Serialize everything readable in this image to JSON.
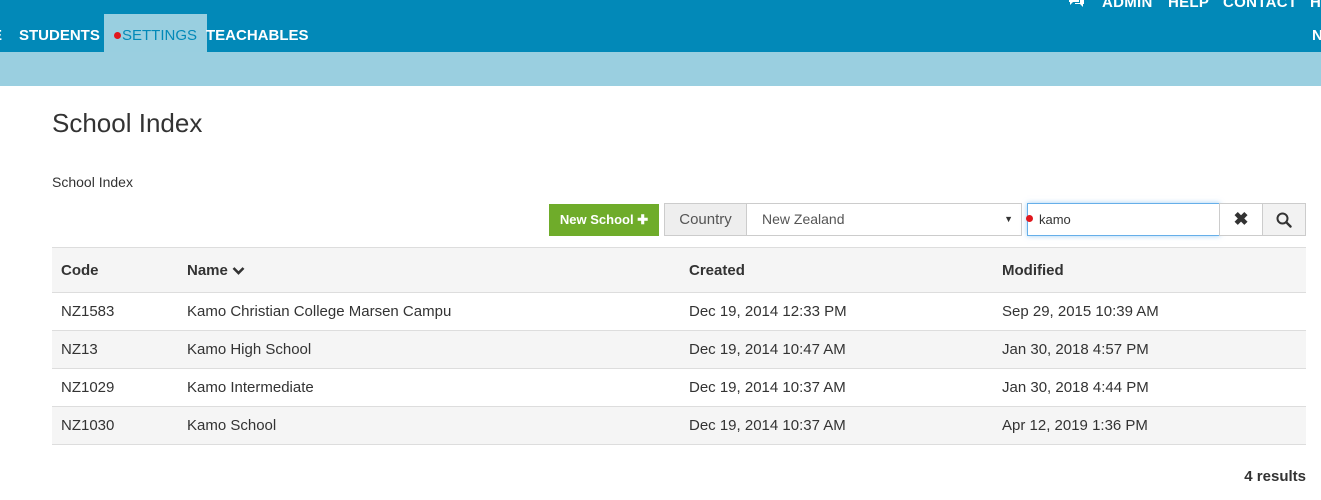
{
  "header": {
    "utility_links": [
      "ADMIN",
      "HELP",
      "CONTACT",
      "H"
    ],
    "nav_partial_left": "E",
    "nav_tabs": [
      {
        "label": "STUDENTS"
      },
      {
        "label": "SETTINGS",
        "active": true
      },
      {
        "label": "TEACHABLES"
      }
    ],
    "nav_partial_right": "N"
  },
  "page": {
    "title": "School Index",
    "breadcrumb": "School Index"
  },
  "toolbar": {
    "new_school_label": "New School",
    "country_label": "Country",
    "country_selected": "New Zealand",
    "search_value": "kamo"
  },
  "table": {
    "columns": [
      "Code",
      "Name",
      "Created",
      "Modified"
    ],
    "sort_column": "Name",
    "rows": [
      {
        "code": "NZ1583",
        "name": "Kamo Christian College Marsen Campu",
        "created": "Dec 19, 2014 12:33 PM",
        "modified": "Sep 29, 2015 10:39 AM"
      },
      {
        "code": "NZ13",
        "name": "Kamo High School",
        "created": "Dec 19, 2014 10:47 AM",
        "modified": "Jan 30, 2018 4:57 PM"
      },
      {
        "code": "NZ1029",
        "name": "Kamo Intermediate",
        "created": "Dec 19, 2014 10:37 AM",
        "modified": "Jan 30, 2018 4:44 PM"
      },
      {
        "code": "NZ1030",
        "name": "Kamo School",
        "created": "Dec 19, 2014 10:37 AM",
        "modified": "Apr 12, 2019 1:36 PM"
      }
    ]
  },
  "footer": {
    "results_count": "4 results"
  },
  "colors": {
    "header_bg": "#0289b8",
    "subbar_bg": "#9acfe0",
    "new_button_bg": "#6fac2a",
    "marker_dot": "#e0171d"
  }
}
